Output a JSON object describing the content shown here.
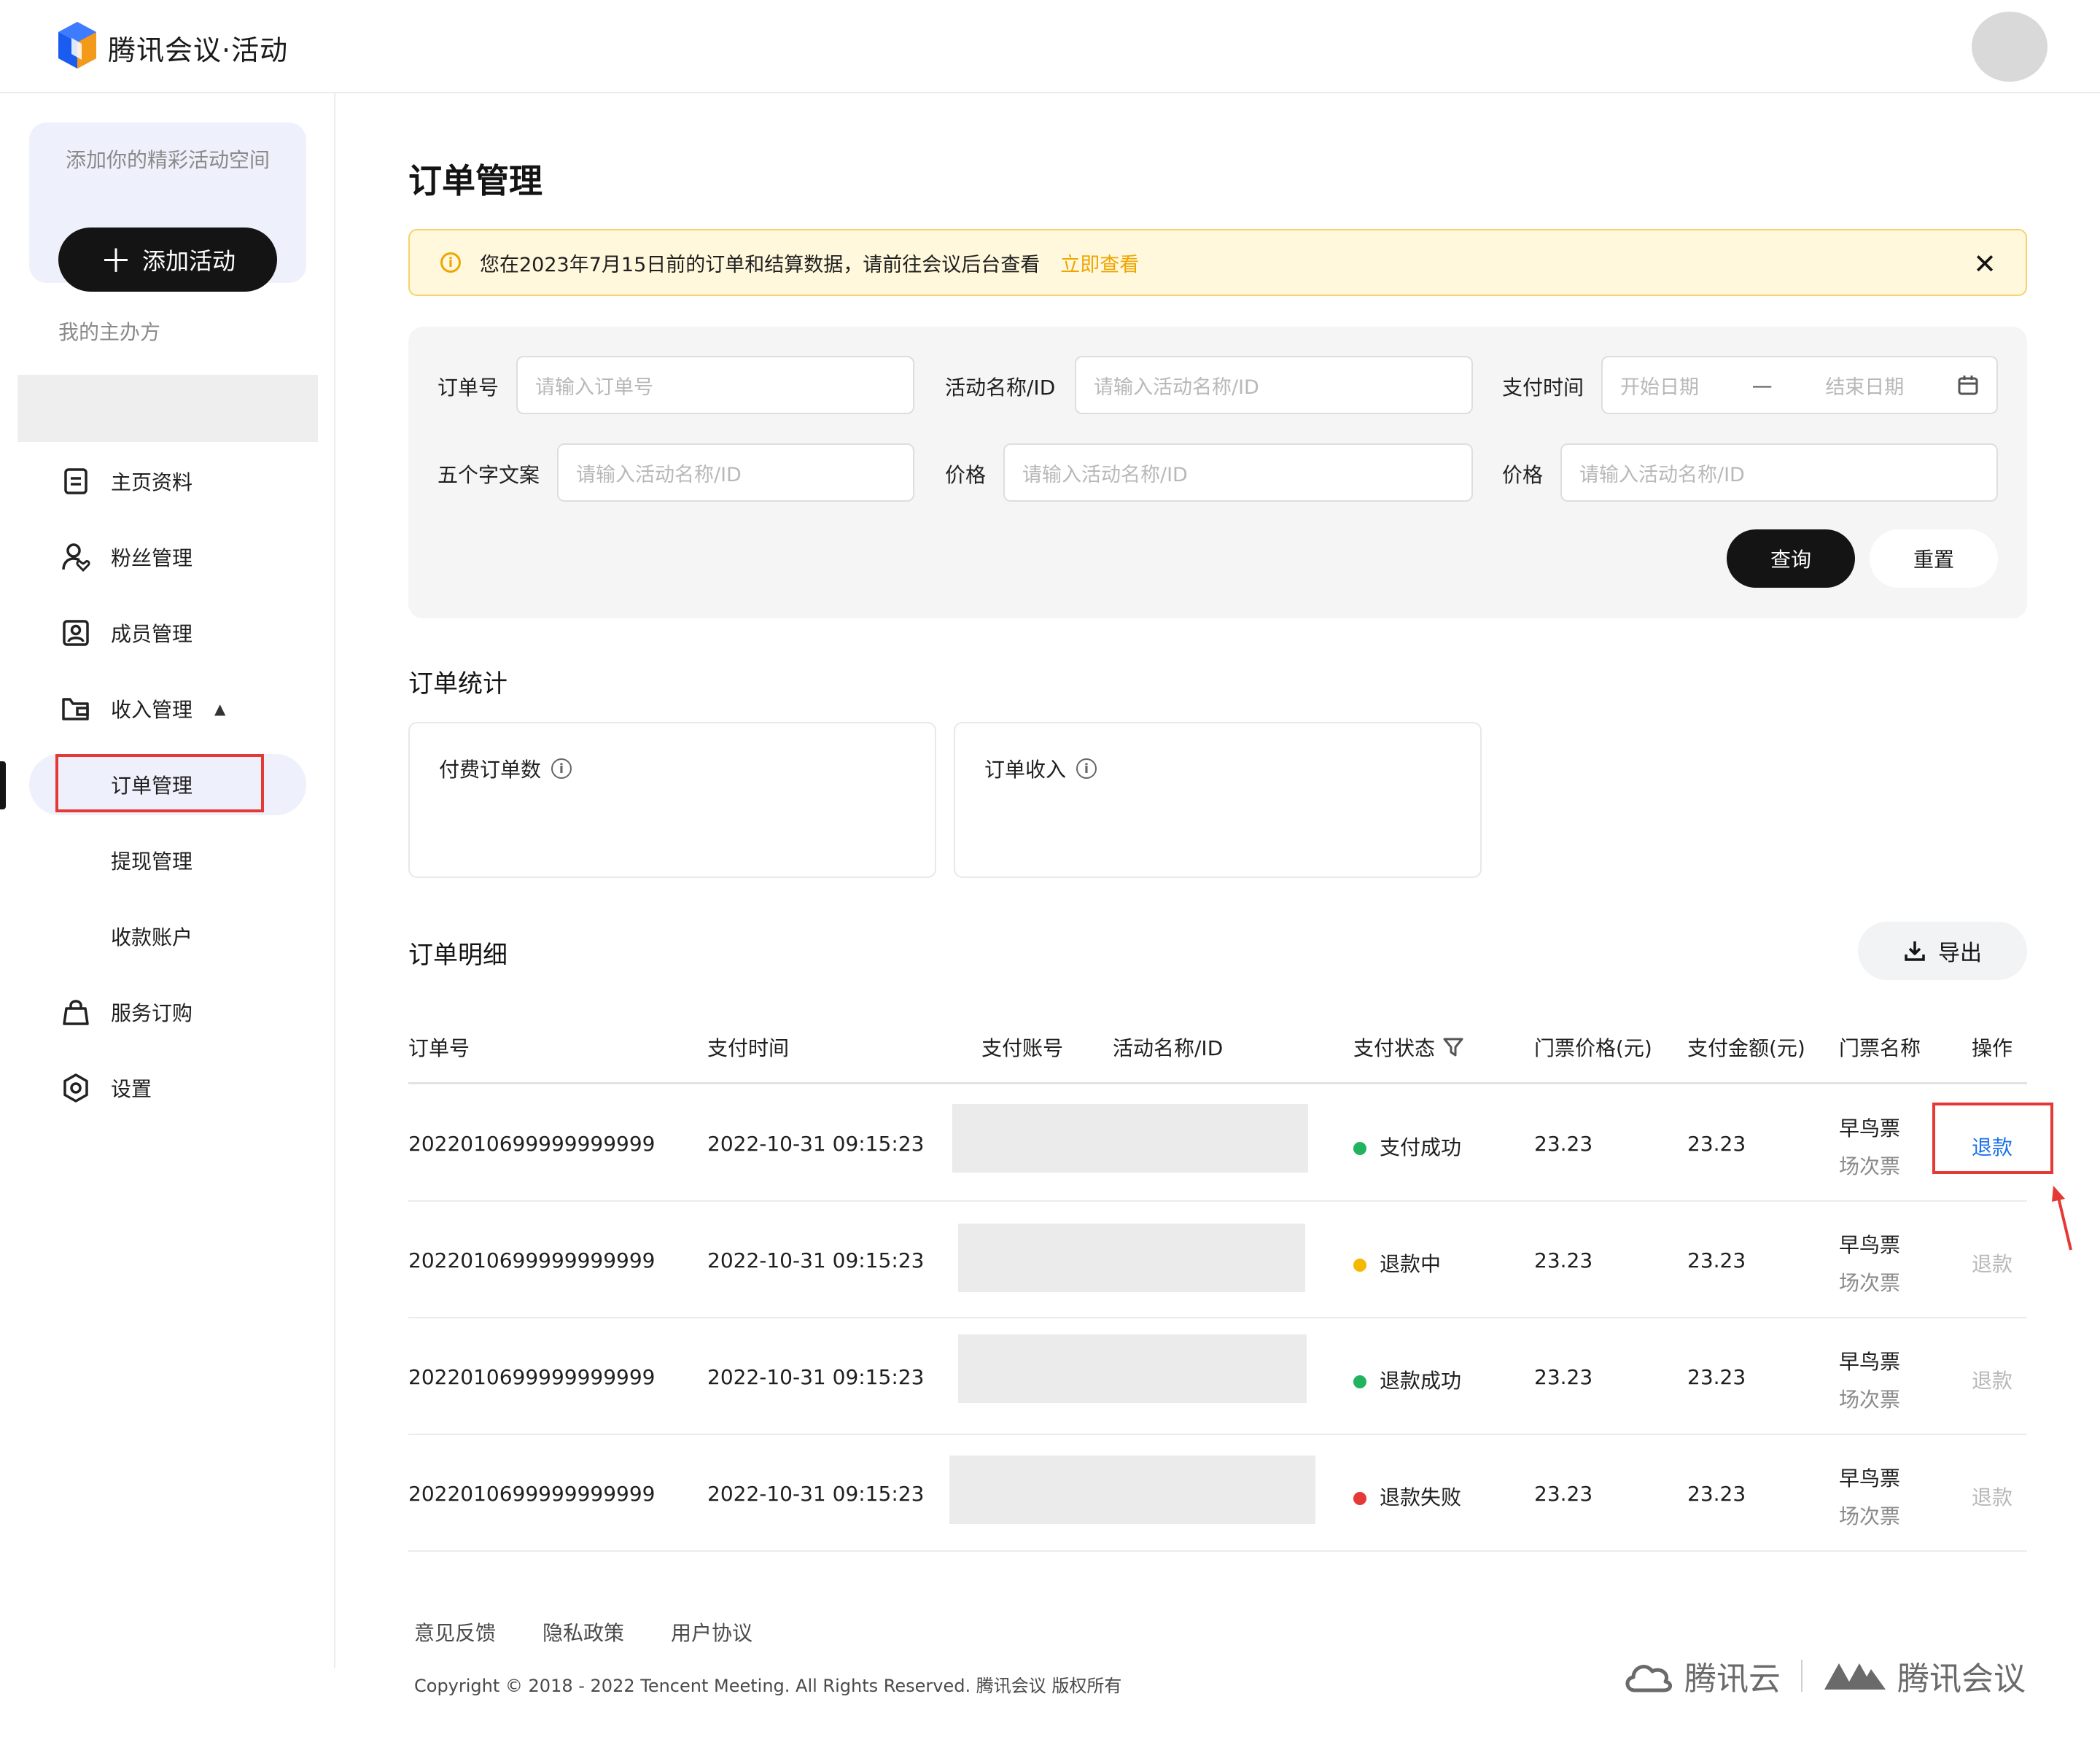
{
  "header": {
    "brand": "腾讯会议·活动"
  },
  "sidebar": {
    "promo_text": "添加你的精彩活动空间",
    "add_button": "添加活动",
    "host_label": "我的主办方",
    "items": [
      {
        "label": "主页资料",
        "icon": "profile-card-icon"
      },
      {
        "label": "粉丝管理",
        "icon": "user-heart-icon"
      },
      {
        "label": "成员管理",
        "icon": "member-badge-icon"
      },
      {
        "label": "收入管理",
        "icon": "wallet-icon"
      },
      {
        "label": "服务订购",
        "icon": "shopping-bag-icon"
      },
      {
        "label": "设置",
        "icon": "gear-icon"
      }
    ],
    "sub_items": [
      {
        "label": "订单管理"
      },
      {
        "label": "提现管理"
      },
      {
        "label": "收款账户"
      }
    ]
  },
  "main": {
    "title": "订单管理",
    "notice": {
      "message": "您在2023年7月15日前的订单和结算数据，请前往会议后台查看",
      "link": "立即查看"
    },
    "filters": {
      "order_no_label": "订单号",
      "order_no_placeholder": "请输入订单号",
      "activity_label": "活动名称/ID",
      "activity_placeholder": "请输入活动名称/ID",
      "pay_time_label": "支付时间",
      "start_placeholder": "开始日期",
      "end_placeholder": "结束日期",
      "five_label": "五个字文案",
      "five_placeholder": "请输入活动名称/ID",
      "price1_label": "价格",
      "price1_placeholder": "请输入活动名称/ID",
      "price2_label": "价格",
      "price2_placeholder": "请输入活动名称/ID",
      "query_button": "查询",
      "reset_button": "重置"
    },
    "stats": {
      "title": "订单统计",
      "cards": [
        {
          "label": "付费订单数"
        },
        {
          "label": "订单收入"
        }
      ]
    },
    "details": {
      "title": "订单明细",
      "export_button": "导出",
      "columns": [
        "订单号",
        "支付时间",
        "支付账号",
        "活动名称/ID",
        "支付状态",
        "门票价格(元)",
        "支付金额(元)",
        "门票名称",
        "操作"
      ],
      "rows": [
        {
          "order_no": "2022010699999999999",
          "pay_time": "2022-10-31 09:15:23",
          "status": "支付成功",
          "status_color": "#22b35e",
          "ticket_price": "23.23",
          "paid_amount": "23.23",
          "ticket_name": "早鸟票",
          "ticket_sub": "场次票",
          "action": "退款",
          "action_enabled": true
        },
        {
          "order_no": "2022010699999999999",
          "pay_time": "2022-10-31 09:15:23",
          "status": "退款中",
          "status_color": "#f5b800",
          "ticket_price": "23.23",
          "paid_amount": "23.23",
          "ticket_name": "早鸟票",
          "ticket_sub": "场次票",
          "action": "退款",
          "action_enabled": false
        },
        {
          "order_no": "2022010699999999999",
          "pay_time": "2022-10-31 09:15:23",
          "status": "退款成功",
          "status_color": "#22b35e",
          "ticket_price": "23.23",
          "paid_amount": "23.23",
          "ticket_name": "早鸟票",
          "ticket_sub": "场次票",
          "action": "退款",
          "action_enabled": false
        },
        {
          "order_no": "2022010699999999999",
          "pay_time": "2022-10-31 09:15:23",
          "status": "退款失败",
          "status_color": "#e53935",
          "ticket_price": "23.23",
          "paid_amount": "23.23",
          "ticket_name": "早鸟票",
          "ticket_sub": "场次票",
          "action": "退款",
          "action_enabled": false
        }
      ]
    }
  },
  "footer": {
    "links": [
      "意见反馈",
      "隐私政策",
      "用户协议"
    ],
    "copyright": "Copyright © 2018 - 2022 Tencent Meeting. All Rights Reserved. 腾讯会议 版权所有",
    "logo_cloud": "腾讯云",
    "logo_meeting": "腾讯会议"
  },
  "colors": {
    "accent": "#141414",
    "link": "#1a73e8",
    "warning": "#f0a500",
    "disabled": "#b8b8b8"
  }
}
